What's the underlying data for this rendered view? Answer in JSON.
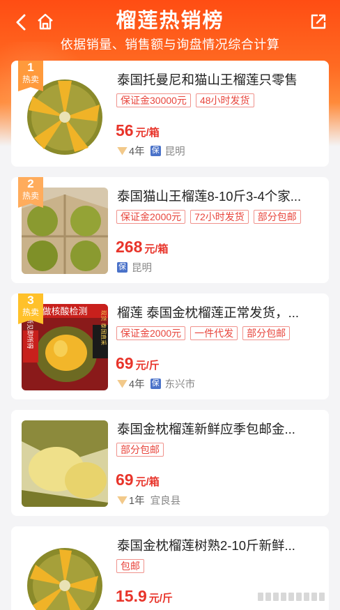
{
  "header": {
    "title": "榴莲热销榜",
    "subtitle": "依据销量、销售额与询盘情况综合计算",
    "back_icon": "chevron-left-icon",
    "home_icon": "home-icon",
    "share_icon": "share-icon"
  },
  "items": [
    {
      "rank": "1",
      "rank_label": "热卖",
      "name": "泰国托曼尼和猫山王榴莲只零售",
      "tags": [
        "保证金30000元",
        "48小时发货"
      ],
      "price": "56",
      "unit": "元/箱",
      "years": "4年",
      "bao": "保",
      "location": "昆明"
    },
    {
      "rank": "2",
      "rank_label": "热卖",
      "name": "泰国猫山王榴莲8-10斤3-4个家...",
      "tags": [
        "保证金2000元",
        "72小时发货",
        "部分包邮"
      ],
      "price": "268",
      "unit": "元/箱",
      "bao": "保",
      "location": "昆明"
    },
    {
      "rank": "3",
      "rank_label": "热卖",
      "name": "榴莲 泰国金枕榴莲正常发货，...",
      "tags": [
        "保证金2000元",
        "一件代发",
        "部分包邮"
      ],
      "price": "69",
      "unit": "元/斤",
      "years": "4年",
      "bao": "保",
      "location": "东兴市",
      "image_text": {
        "top": "做核酸检测",
        "left": "所见即所得",
        "right": "现货 泰国直采"
      }
    },
    {
      "name": "泰国金枕榴莲新鲜应季包邮金...",
      "tags": [
        "部分包邮"
      ],
      "price": "69",
      "unit": "元/箱",
      "years": "1年",
      "location": "宜良县"
    },
    {
      "name": "泰国金枕榴莲树熟2-10斤新鲜...",
      "tags": [
        "包邮"
      ],
      "price": "15.9",
      "unit": "元/斤"
    }
  ],
  "colors": {
    "header": "#ff5a1a",
    "price": "#e8342a",
    "tag": "#e8453c",
    "rank_badge": "#ff9a3c",
    "bao_badge": "#4a72c9"
  }
}
